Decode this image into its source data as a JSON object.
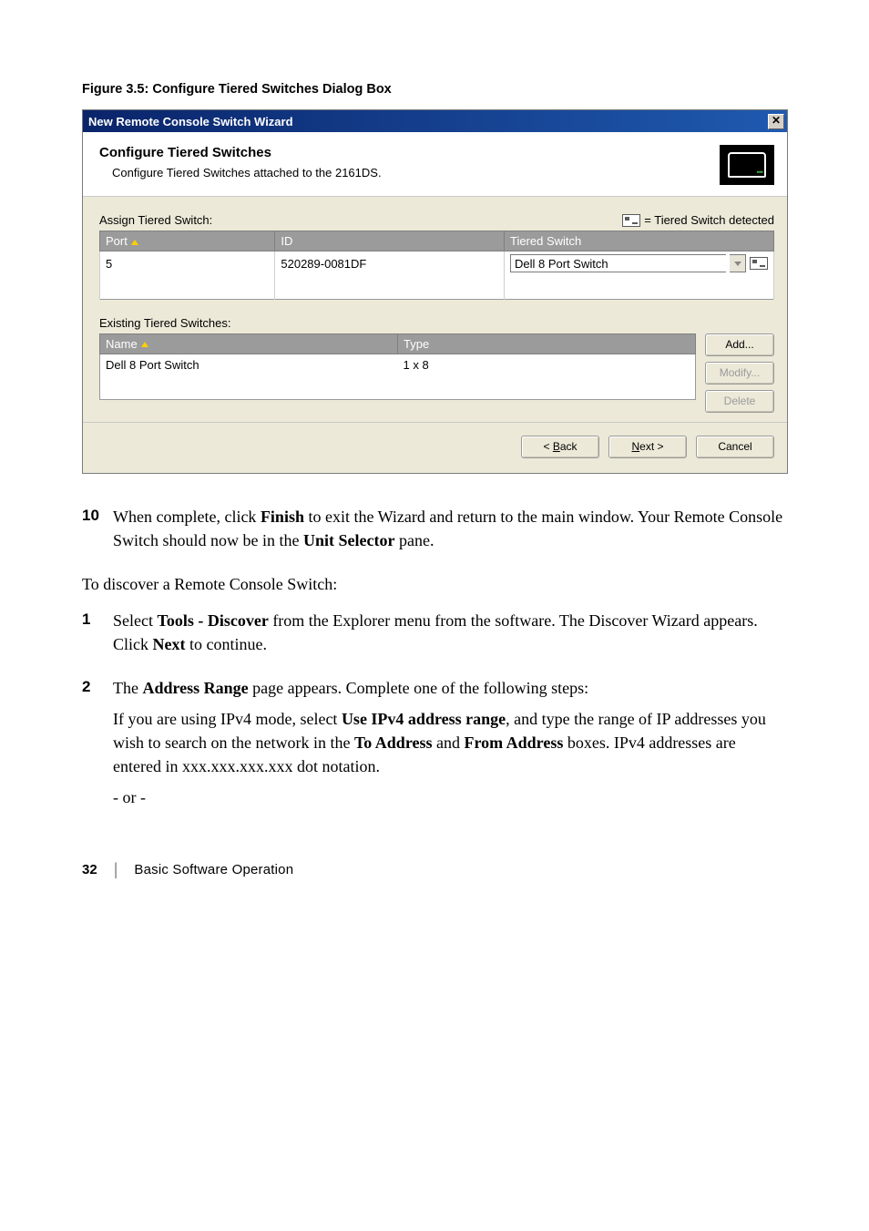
{
  "caption": "Figure 3.5: Configure Tiered Switches Dialog Box",
  "dialog": {
    "title": "New Remote Console Switch Wizard",
    "close_glyph": "✕",
    "head_title": "Configure Tiered Switches",
    "head_sub": "Configure Tiered Switches attached to the 2161DS.",
    "assign_label": "Assign Tiered Switch:",
    "legend_text": " = Tiered Switch detected",
    "assign_cols": {
      "port": "Port",
      "id": "ID",
      "ts": "Tiered Switch"
    },
    "assign_row": {
      "port": "5",
      "id": "520289-0081DF",
      "ts": "Dell 8 Port Switch"
    },
    "existing_label": "Existing Tiered Switches:",
    "existing_cols": {
      "name": "Name",
      "type": "Type"
    },
    "existing_row": {
      "name": "Dell 8 Port Switch",
      "type": "1 x 8"
    },
    "btn_add": "Add...",
    "btn_modify": "Modify...",
    "btn_delete": "Delete",
    "btn_back_pre": "< ",
    "btn_back_u": "B",
    "btn_back_post": "ack",
    "btn_next_u": "N",
    "btn_next_post": "ext >",
    "btn_cancel": "Cancel"
  },
  "body": {
    "step10_num": "10",
    "step10_a": "When complete, click ",
    "step10_b": "Finish",
    "step10_c": " to exit the Wizard and return to the main window. Your Remote Console Switch should now be in the ",
    "step10_d": "Unit Selector",
    "step10_e": " pane.",
    "intro": "To discover a Remote Console Switch:",
    "step1_num": "1",
    "step1_a": "Select ",
    "step1_b": "Tools - Discover",
    "step1_c": " from the Explorer menu from the software. The Discover Wizard appears. Click ",
    "step1_d": "Next",
    "step1_e": " to continue.",
    "step2_num": "2",
    "step2_a": "The ",
    "step2_b": "Address Range",
    "step2_c": " page appears. Complete one of the following steps:",
    "step2_p2_a": "If you are using IPv4 mode, select ",
    "step2_p2_b": "Use IPv4 address range",
    "step2_p2_c": ", and type the range of IP addresses you wish to search on the network in the ",
    "step2_p2_d": "To Address",
    "step2_p2_e": " and ",
    "step2_p2_f": "From Address",
    "step2_p2_g": " boxes. IPv4 addresses are entered in xxx.xxx.xxx.xxx dot notation.",
    "step2_or": "- or -"
  },
  "footer": {
    "page": "32",
    "sep": "|",
    "label": "Basic Software Operation"
  }
}
